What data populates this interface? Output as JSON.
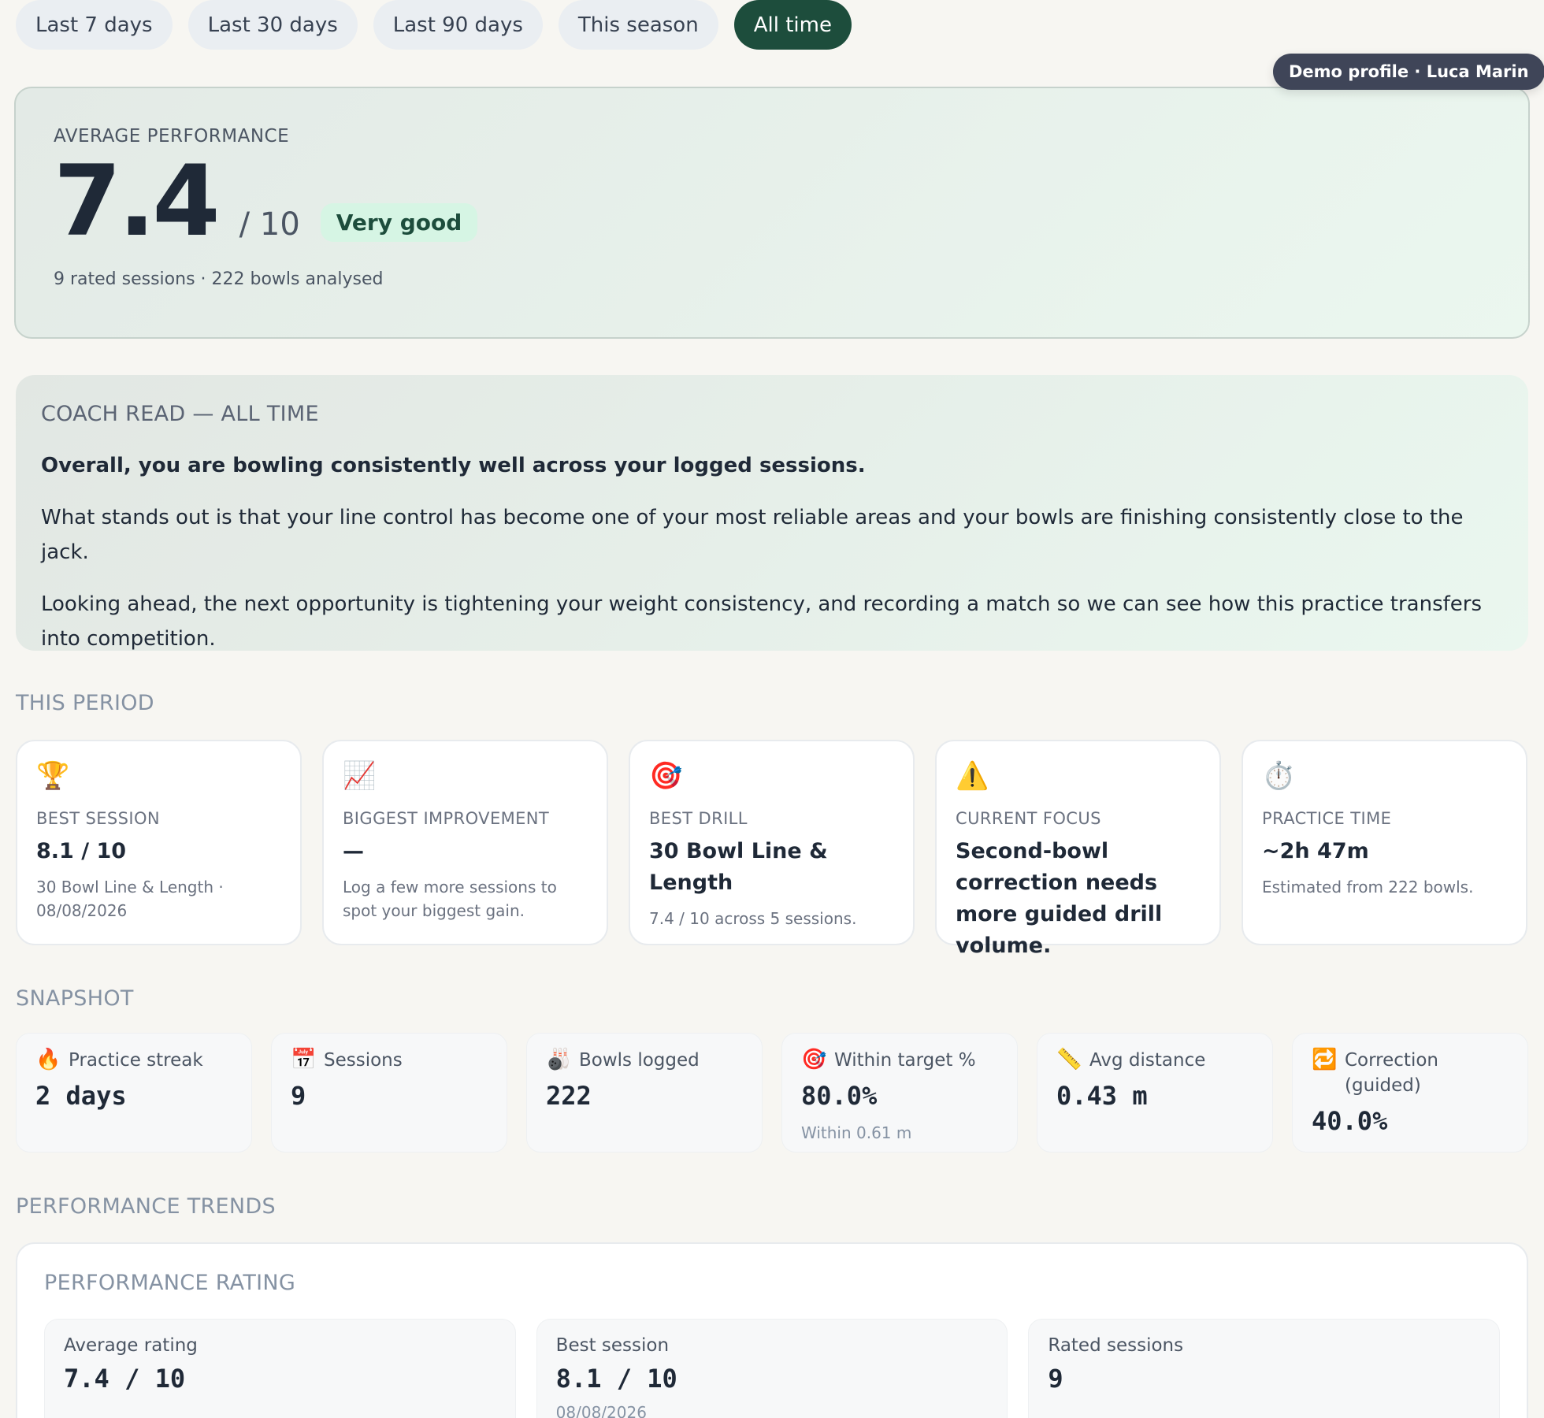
{
  "filters": [
    {
      "label": "Last 7 days",
      "active": false
    },
    {
      "label": "Last 30 days",
      "active": false
    },
    {
      "label": "Last 90 days",
      "active": false
    },
    {
      "label": "This season",
      "active": false
    },
    {
      "label": "All time",
      "active": true
    }
  ],
  "demo_badge": "Demo profile · Luca Marin",
  "hero": {
    "label": "AVERAGE PERFORMANCE",
    "score": "7.4",
    "out_of": "/ 10",
    "rating_badge": "Very good",
    "summary": "9 rated sessions · 222 bowls analysed"
  },
  "coach": {
    "title": "COACH READ — ALL TIME",
    "lead": "Overall, you are bowling consistently well across your logged sessions.",
    "p1": "What stands out is that your line control has become one of your most reliable areas and your bowls are finishing consistently close to the jack.",
    "p2": "Looking ahead, the next opportunity is tightening your weight consistency, and recording a match so we can see how this practice transfers into competition."
  },
  "sections": {
    "this_period": "THIS PERIOD",
    "snapshot": "SNAPSHOT",
    "performance_trends": "PERFORMANCE TRENDS"
  },
  "period_cards": [
    {
      "icon": "🏆",
      "icon_name": "trophy-icon",
      "label": "BEST SESSION",
      "value": "8.1 / 10",
      "note": "30 Bowl Line & Length · 08/08/2026"
    },
    {
      "icon": "📈",
      "icon_name": "chart-increasing-icon",
      "label": "BIGGEST IMPROVEMENT",
      "value": "—",
      "note": "Log a few more sessions to spot your biggest gain."
    },
    {
      "icon": "🎯",
      "icon_name": "target-icon",
      "label": "BEST DRILL",
      "value": "30 Bowl Line & Length",
      "note": "7.4 / 10 across 5 sessions."
    },
    {
      "icon": "⚠️",
      "icon_name": "warning-icon",
      "label": "CURRENT FOCUS",
      "value": "Second-bowl correction needs more guided drill volume.",
      "note": ""
    },
    {
      "icon": "⏱️",
      "icon_name": "stopwatch-icon",
      "label": "PRACTICE TIME",
      "value": "~2h 47m",
      "note": "Estimated from 222 bowls."
    }
  ],
  "snapshot": [
    {
      "icon": "🔥",
      "icon_name": "fire-icon",
      "label": "Practice streak",
      "value": "2 days",
      "note": ""
    },
    {
      "icon": "📅",
      "icon_name": "calendar-icon",
      "label": "Sessions",
      "value": "9",
      "note": ""
    },
    {
      "icon": "🎳",
      "icon_name": "bowling-icon",
      "label": "Bowls logged",
      "value": "222",
      "note": ""
    },
    {
      "icon": "🎯",
      "icon_name": "target-icon",
      "label": "Within target %",
      "value": "80.0%",
      "note": "Within 0.61 m"
    },
    {
      "icon": "📏",
      "icon_name": "ruler-icon",
      "label": "Avg distance",
      "value": "0.43 m",
      "note": ""
    },
    {
      "icon": "🔁",
      "icon_name": "repeat-icon",
      "label": "Correction (guided)",
      "value": "40.0%",
      "note": ""
    }
  ],
  "trends": {
    "title": "PERFORMANCE RATING",
    "cards": [
      {
        "label": "Average rating",
        "value": "7.4 / 10",
        "note": ""
      },
      {
        "label": "Best session",
        "value": "8.1 / 10",
        "note": "08/08/2026"
      },
      {
        "label": "Rated sessions",
        "value": "9",
        "note": ""
      }
    ]
  }
}
